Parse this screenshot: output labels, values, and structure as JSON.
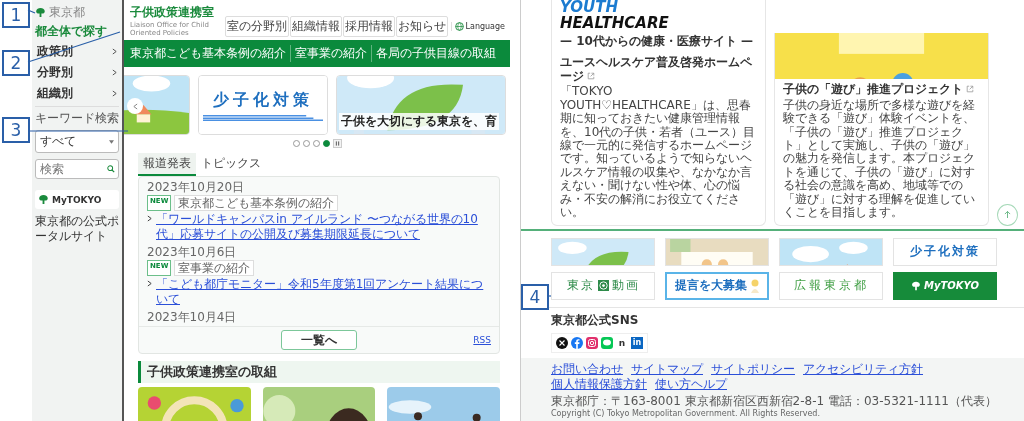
{
  "callouts": [
    "1",
    "2",
    "3",
    "4"
  ],
  "left_page": {
    "sidebar": {
      "logo": "東京都",
      "search_all": "都全体で探す",
      "menu": [
        {
          "label": "政策別"
        },
        {
          "label": "分野別"
        },
        {
          "label": "組織別"
        }
      ],
      "keyword_label": "キーワード検索",
      "select": {
        "value": "すべて"
      },
      "search": {
        "placeholder": "検索"
      },
      "mytokyo": "MyTOKYO",
      "portal_text": "東京都の公式ポータルサイト"
    },
    "header": {
      "title": "子供政策連携室",
      "subtitle": "Liaison Office for Child Oriented Policies",
      "utility_links": [
        "室の分野別",
        "組織情報",
        "採用情報",
        "お知らせ"
      ],
      "language": "Language"
    },
    "nav": [
      "東京都こども基本条例の紹介",
      "室事業の紹介",
      "各局の子供目線の取組"
    ],
    "carousel": {
      "slides": [
        {
          "kind": "picture"
        },
        {
          "kind": "banner",
          "text": "少子化対策"
        },
        {
          "kind": "captioned",
          "caption": "子供を大切にする東京を、育"
        }
      ],
      "dots": [
        {
          "selected": false
        },
        {
          "selected": false
        },
        {
          "selected": false
        },
        {
          "selected": true
        }
      ]
    },
    "news": {
      "tabs": [
        {
          "label": "報道発表",
          "selected": true
        },
        {
          "label": "トピックス",
          "selected": false
        }
      ],
      "items": [
        {
          "date": "2023年10月20日",
          "badge": "NEW",
          "category": "東京都こども基本条例の紹介",
          "link": "「ワールドキャンパスin アイルランド 〜つながる世界の10代」応募サイトの公開及び募集期限延長について"
        },
        {
          "date": "2023年10月6日",
          "badge": "NEW",
          "category": "室事業の紹介",
          "link": "「こども都庁モニター」令和5年度第1回アンケート結果について"
        },
        {
          "date": "2023年10月4日"
        }
      ],
      "more": "一覧へ",
      "rss": "RSS"
    },
    "section": {
      "heading": "子供政策連携室の取組",
      "cards": [
        {
          "kind": "picture"
        },
        {
          "kind": "picture"
        },
        {
          "kind": "picture"
        }
      ]
    }
  },
  "right_page": {
    "cards": [
      {
        "kind": "logo",
        "logo_lines": [
          "YOUTH",
          "HEALTHCARE"
        ],
        "tagline": "— 10代からの健康・医療サイト —",
        "title": "ユースヘルスケア普及啓発ホームページ",
        "description": "「TOKYO YOUTH♡HEALTHCARE」は、思春期に知っておきたい健康管理情報を、10代の子供・若者（ユース）目線で一元的に発信するホームページです。知っているようで知らないヘルスケア情報の収集や、なかなか言えない・聞けない性や体、心の悩み・不安の解消にお役立てください。"
      },
      {
        "kind": "picture",
        "title": "子供の「遊び」推進プロジェクト",
        "description": "子供の身近な場所で多様な遊びを経験できる「遊び」体験イベントを、「子供の「遊び」推進プロジェクト」として実施し、子供の「遊び」の魅力を発信します。本プロジェクトを通じて、子供の「遊び」に対する社会の意識を高め、地域等での「遊び」に対する理解を促進していくことを目指します。"
      }
    ],
    "banners": [
      {
        "kind": "picture"
      },
      {
        "kind": "picture"
      },
      {
        "kind": "picture"
      },
      {
        "kind": "shoushika",
        "text": "少子化対策"
      },
      {
        "kind": "douga",
        "text_before": "東京",
        "text_after": "動画"
      },
      {
        "kind": "teigen",
        "text": "提言を大募集"
      },
      {
        "kind": "kouhou",
        "text": "広報東京都"
      },
      {
        "kind": "mytokyo",
        "text": "MyTOKYO"
      }
    ],
    "sns": {
      "heading": "東京都公式SNS",
      "icons": [
        {
          "kind": "x"
        },
        {
          "kind": "facebook"
        },
        {
          "kind": "instagram"
        },
        {
          "kind": "line"
        },
        {
          "kind": "note",
          "label": "n"
        },
        {
          "kind": "linkedin",
          "label": "in"
        }
      ]
    },
    "footer": {
      "links": [
        "お問い合わせ",
        "サイトマップ",
        "サイトポリシー",
        "アクセシビリティ方針",
        "個人情報保護方針",
        "使い方ヘルプ"
      ],
      "address": "東京都庁：〒163-8001 東京都新宿区西新宿2-8-1 電話：03-5321-1111（代表）",
      "copyright": "Copyright (C) Tokyo Metropolitan Government. All Rights Reserved."
    }
  }
}
